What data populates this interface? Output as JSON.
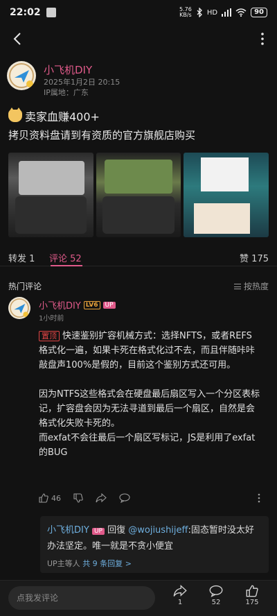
{
  "status_bar": {
    "time": "22:02",
    "net_speed": "5.76",
    "net_unit": "KB/s",
    "network": "HD",
    "battery": "90"
  },
  "post": {
    "author": "小飞机DIY",
    "time": "2025年1月2日 20:15",
    "ip": "IP属地：广东",
    "title": "卖家血赚400+",
    "body": "拷贝资料盘请到有资质的官方旗舰店购买"
  },
  "tabs": {
    "repost": "转发 1",
    "comment": "评论 52",
    "like": "赞 175"
  },
  "comments_header": {
    "title": "热门评论",
    "sort": "按热度"
  },
  "comment": {
    "author": "小飞机DIY",
    "level": "LV6",
    "badge": "UP",
    "time": "1小时前",
    "pin": "置顶",
    "para1": "快速鉴别扩容机械方式：选择NFTS，或者REFS格式化一遍，如果卡死在格式化过不去，而且伴随咔咔敲盘声100%是假的，目前这个鉴别方式还可用。",
    "para2": "因为NTFS这些格式会在硬盘最后扇区写入一个分区表标记，扩容盘会因为无法寻道到最后一个扇区，自然是会格式化失败卡死的。",
    "para3": "而exfat不会往最后一个扇区写标记，JS是利用了exfat的BUG",
    "likes": "46"
  },
  "reply": {
    "author": "小飞机DIY",
    "badge": "UP",
    "reply_word": "回復",
    "mention": "@wojiushijeff",
    "text": ":固态暂时没太好办法坚定。唯一就是不贪小便宜",
    "more_prefix": "UP主等人",
    "more_link": "共 9 条回复",
    "more_arrow": ">"
  },
  "bottom_bar": {
    "placeholder": "点我发评论",
    "share_count": "1",
    "comment_count": "52",
    "like_count": "175"
  }
}
